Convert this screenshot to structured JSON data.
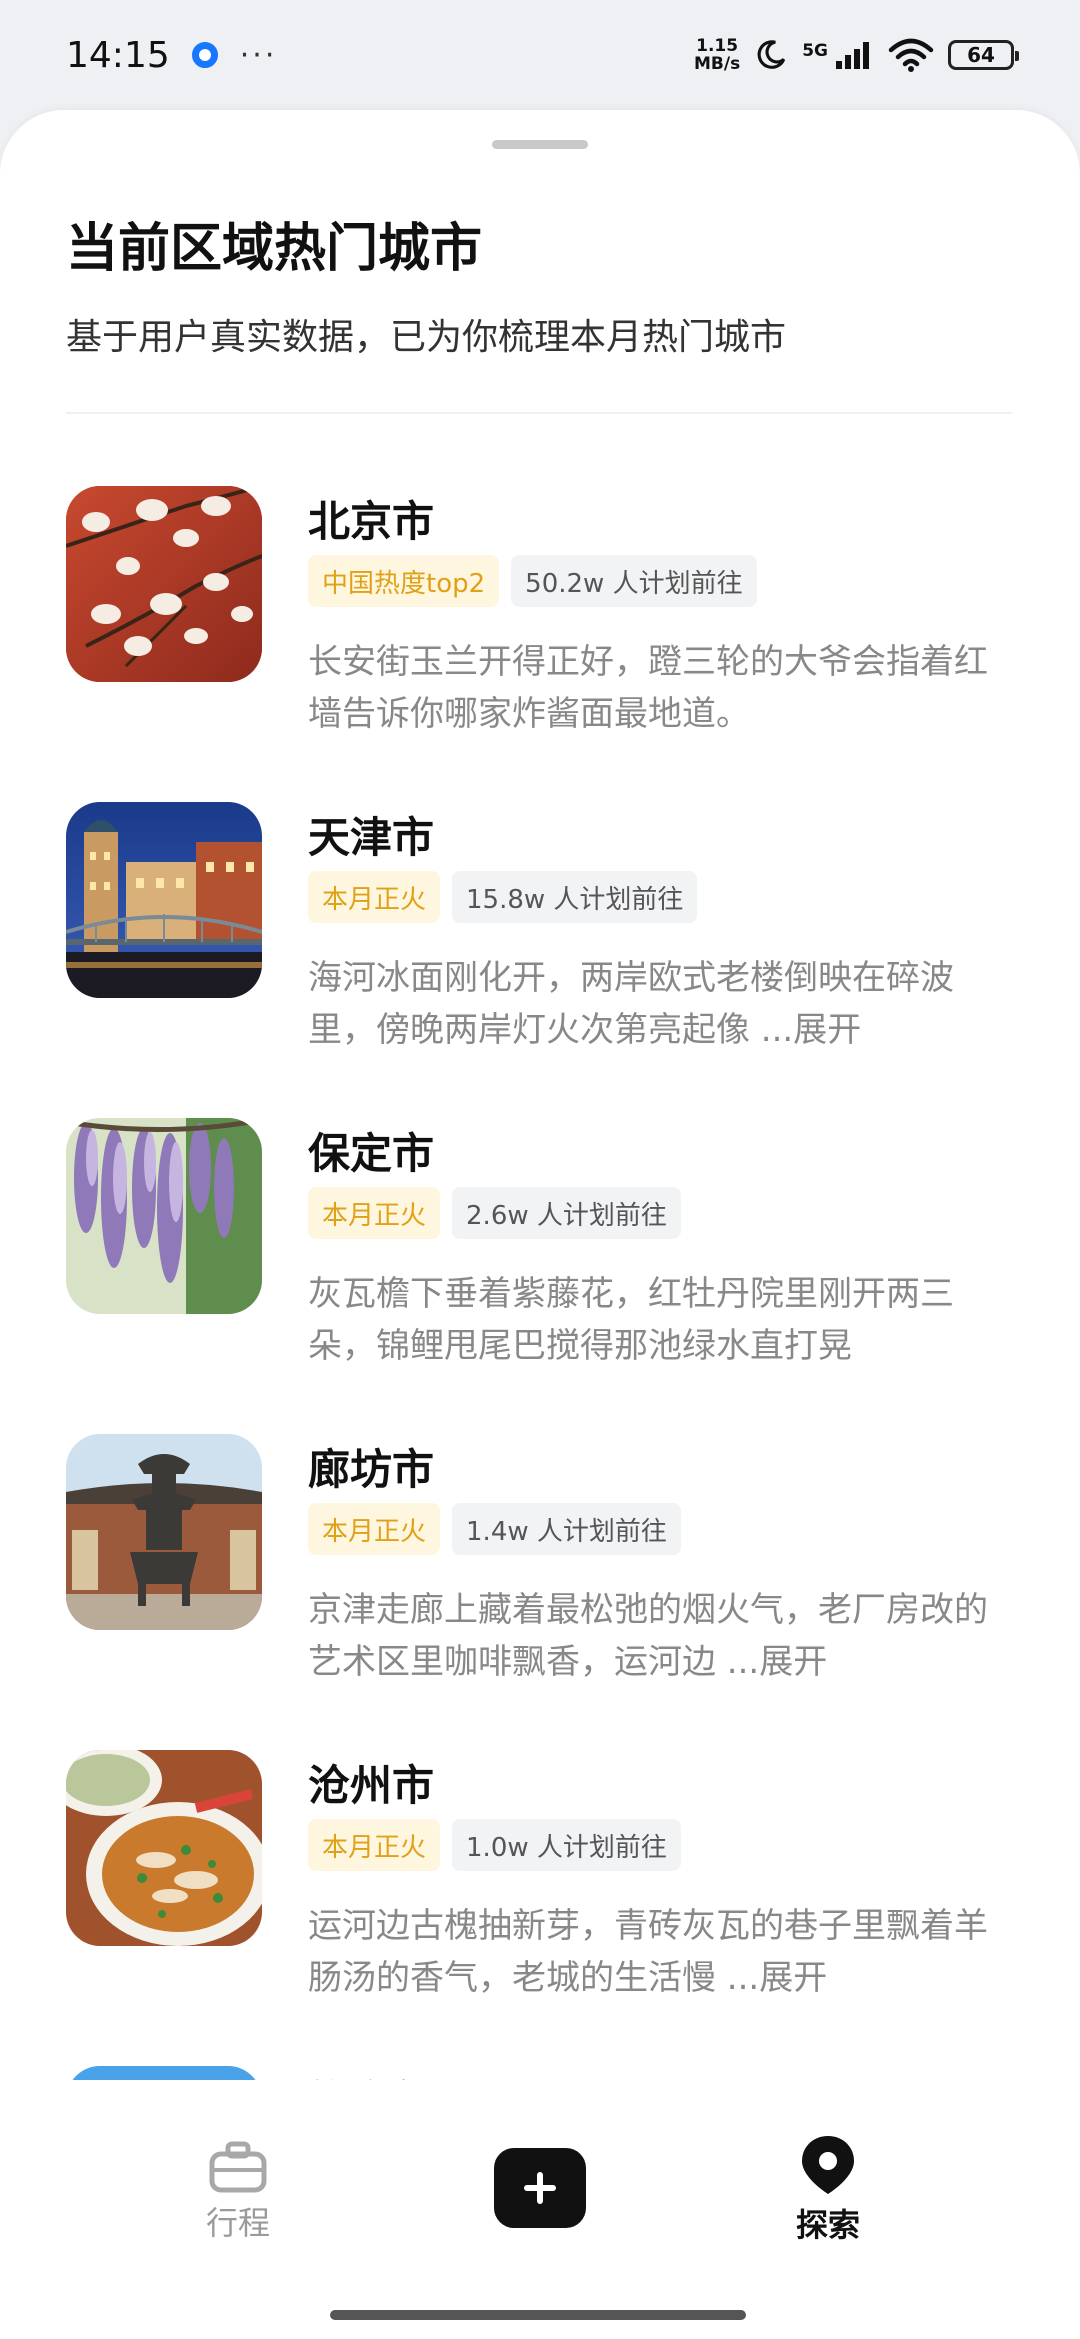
{
  "status_bar": {
    "time": "14:15",
    "more": "···",
    "net_speed_value": "1.15",
    "net_speed_unit": "MB/s",
    "network": "5G",
    "battery": "64"
  },
  "header": {
    "title": "当前区域热门城市",
    "subtitle": "基于用户真实数据，已为你梳理本月热门城市"
  },
  "cities": [
    {
      "name": "北京市",
      "tag": "中国热度top2",
      "count": "50.2w 人计划前往",
      "desc": "长安街玉兰开得正好，蹬三轮的大爷会指着红墙告诉你哪家炸酱面最地道。"
    },
    {
      "name": "天津市",
      "tag": "本月正火",
      "count": "15.8w 人计划前往",
      "desc": "海河冰面刚化开，两岸欧式老楼倒映在碎波里，傍晚两岸灯火次第亮起像 ...展开"
    },
    {
      "name": "保定市",
      "tag": "本月正火",
      "count": "2.6w 人计划前往",
      "desc": "灰瓦檐下垂着紫藤花，红牡丹院里刚开两三朵，锦鲤甩尾巴搅得那池绿水直打晃"
    },
    {
      "name": "廊坊市",
      "tag": "本月正火",
      "count": "1.4w 人计划前往",
      "desc": "京津走廊上藏着最松弛的烟火气，老厂房改的艺术区里咖啡飘香，运河边 ...展开"
    },
    {
      "name": "沧州市",
      "tag": "本月正火",
      "count": "1.0w 人计划前往",
      "desc": "运河边古槐抽新芽，青砖灰瓦的巷子里飘着羊肠汤的香气，老城的生活慢 ...展开"
    },
    {
      "name": "雄安新区",
      "tag": "",
      "count": "",
      "desc": ""
    }
  ],
  "bottom_nav": {
    "trip_label": "行程",
    "add_icon": "plus-icon",
    "explore_label": "探索"
  },
  "colors": {
    "hot_tag_text": "#e0a116",
    "hot_tag_bg": "#fff6e0",
    "count_tag_bg": "#f2f3f5",
    "desc_text": "#888888"
  }
}
